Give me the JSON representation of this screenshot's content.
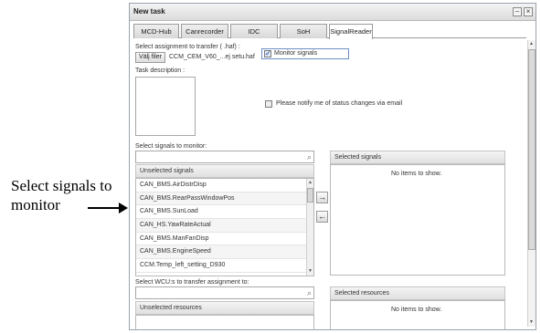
{
  "annotation": {
    "text": "Select signals to monitor"
  },
  "window": {
    "title": "New task",
    "minimize_label": "–",
    "close_label": "×"
  },
  "tabs": [
    {
      "label": "MCD-Hub"
    },
    {
      "label": "Canrecorder"
    },
    {
      "label": "IDC"
    },
    {
      "label": "SoH"
    },
    {
      "label": "SignalReader"
    }
  ],
  "assignment": {
    "label": "Select assignment to transfer ( .haf) :",
    "choose_button": "Välj filer",
    "filename": "CCM_CEM_V60_...ej setu.haf"
  },
  "monitor_signals": {
    "label": "Monitor signals",
    "checked": true
  },
  "task_description": {
    "label": "Task description :"
  },
  "notify": {
    "label": "Please notify me of status changes via email",
    "checked": false
  },
  "signals": {
    "section_label": "Select signals to monitor:",
    "unselected_header": "Unselected signals",
    "selected_header": "Selected signals",
    "selected_empty": "No items to show.",
    "items": [
      "CAN_BMS.AirDistrDisp",
      "CAN_BMS.RearPassWindowPos",
      "CAN_BMS.SunLoad",
      "CAN_HS.YawRateActual",
      "CAN_BMS.ManFanDisp",
      "CAN_BMS.EngineSpeed",
      "CCM.Temp_left_setting_D930"
    ],
    "add_arrow": "→",
    "remove_arrow": "←"
  },
  "wcu": {
    "section_label": "Select WCU:s to transfer assignment to:",
    "unselected_header": "Unselected resources",
    "selected_header": "Selected resources",
    "selected_empty": "No items to show."
  },
  "icons": {
    "search": "magnifier-icon",
    "scroll_up": "▲",
    "scroll_down": "▼",
    "search_glyph": "⌕"
  }
}
